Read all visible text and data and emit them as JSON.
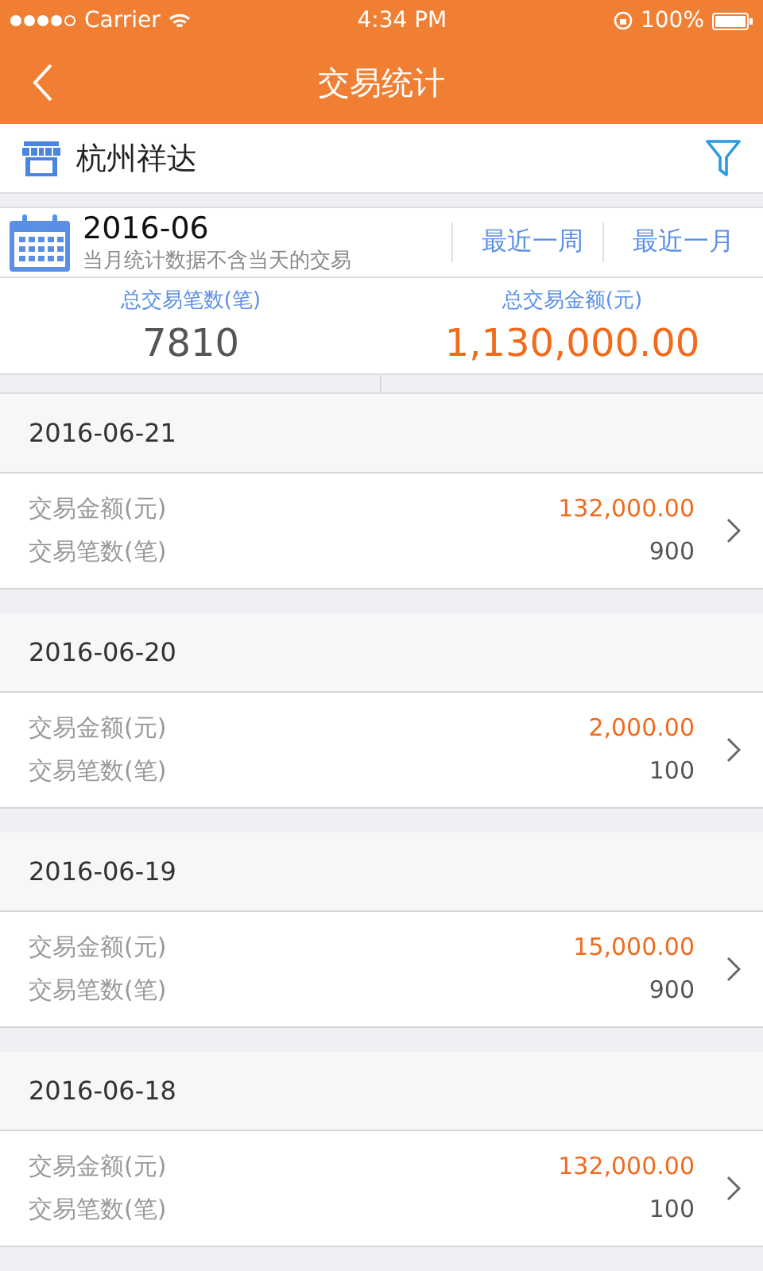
{
  "status_bar": {
    "carrier": "Carrier",
    "time": "4:34 PM",
    "battery": "100%"
  },
  "nav": {
    "title": "交易统计"
  },
  "store": {
    "name": "杭州祥达"
  },
  "period": {
    "month": "2016-06",
    "note": "当月统计数据不含当天的交易",
    "filters": [
      {
        "label": "最近一周",
        "selected": false
      },
      {
        "label": "最近一月",
        "selected": false
      }
    ]
  },
  "totals": [
    {
      "kind": "count",
      "label": "总交易笔数(笔)",
      "value": "7810"
    },
    {
      "kind": "amount",
      "label": "总交易金额(元)",
      "value": "1,130,000.00"
    }
  ],
  "days": [
    {
      "date": "2016-06-21",
      "amount_label": "交易金额(元)",
      "amount": "132,000.00",
      "count_label": "交易笔数(笔)",
      "count": "900"
    },
    {
      "date": "2016-06-20",
      "amount_label": "交易金额(元)",
      "amount": "2,000.00",
      "count_label": "交易笔数(笔)",
      "count": "100"
    },
    {
      "date": "2016-06-19",
      "amount_label": "交易金额(元)",
      "amount": "15,000.00",
      "count_label": "交易笔数(笔)",
      "count": "900"
    },
    {
      "date": "2016-06-18",
      "amount_label": "交易金额(元)",
      "amount": "132,000.00",
      "count_label": "交易笔数(笔)",
      "count": "100"
    }
  ]
}
